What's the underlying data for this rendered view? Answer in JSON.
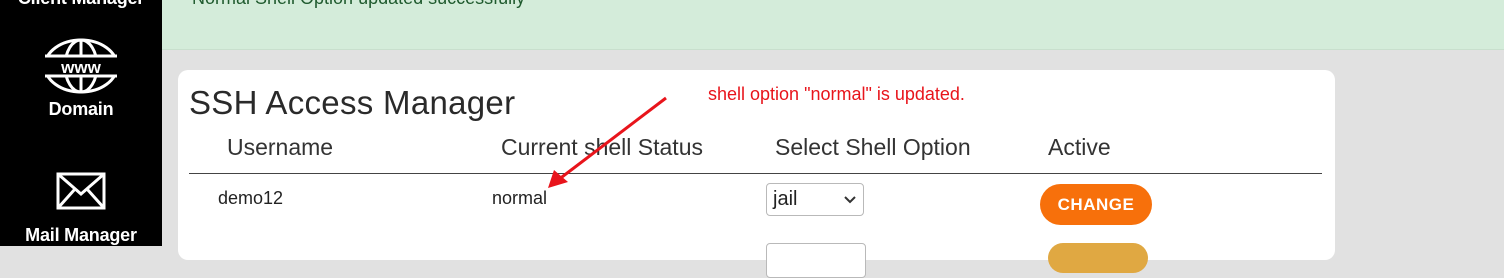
{
  "sidebar": {
    "items": [
      {
        "label": "Client Manager",
        "icon": "user-icon"
      },
      {
        "label": "Domain",
        "icon": "www-globe-icon"
      },
      {
        "label": "Mail Manager",
        "icon": "envelope-icon"
      }
    ]
  },
  "alert": {
    "message": "Normal Shell Option updated successfully",
    "color": "#d4ecda"
  },
  "card": {
    "title": "SSH Access Manager",
    "columns": [
      "Username",
      "Current shell Status",
      "Select Shell Option",
      "Active"
    ],
    "rows": [
      {
        "username": "demo12",
        "status": "normal",
        "shell_option": "jail",
        "action_label": "CHANGE"
      }
    ]
  },
  "annotation": {
    "text": "shell option \"normal\" is updated.",
    "color": "#e8141b"
  },
  "colors": {
    "accent": "#f7700b",
    "sidebar": "#000000"
  }
}
